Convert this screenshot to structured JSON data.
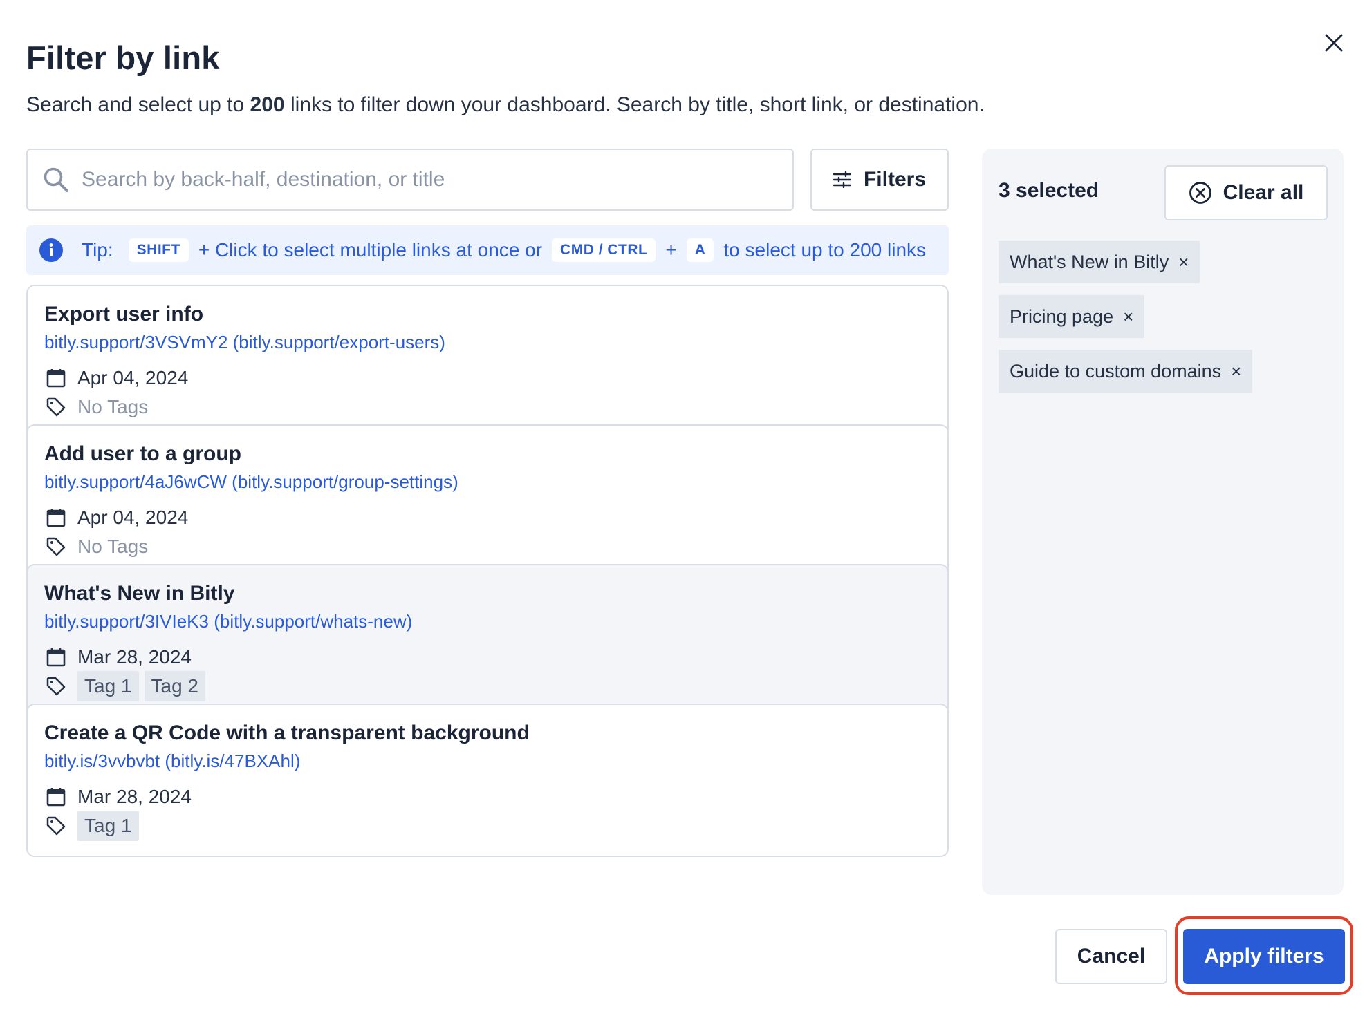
{
  "modal": {
    "title": "Filter by link",
    "subtitle_pre": "Search and select up to ",
    "subtitle_bold": "200",
    "subtitle_post": " links to filter down your dashboard. Search by title, short link, or destination.",
    "close_icon": "close-icon"
  },
  "search": {
    "placeholder": "Search by back-half, destination, or title",
    "value": "",
    "icon": "search-icon"
  },
  "filters_button": {
    "label": "Filters",
    "icon": "sliders-icon"
  },
  "tip": {
    "label": "Tip:",
    "key1": "SHIFT",
    "text1": "+ Click to select multiple links at once or",
    "key2": "CMD / CTRL",
    "plus": "+",
    "key3": "A",
    "text2": "to select up to 200 links",
    "icon": "info-icon"
  },
  "links": [
    {
      "title": "Export user info",
      "link": "bitly.support/3VSVmY2 (bitly.support/export-users)",
      "date": "Apr 04, 2024",
      "no_tags": "No Tags",
      "tags": [],
      "selected": false
    },
    {
      "title": "Add user to a group",
      "link": "bitly.support/4aJ6wCW (bitly.support/group-settings)",
      "date": "Apr 04, 2024",
      "no_tags": "No Tags",
      "tags": [],
      "selected": false
    },
    {
      "title": "What's New in Bitly",
      "link": "bitly.support/3IVIeK3 (bitly.support/whats-new)",
      "date": "Mar 28, 2024",
      "tags": [
        "Tag 1",
        "Tag 2"
      ],
      "selected": true
    },
    {
      "title": "Create a QR Code with a transparent background",
      "link": "bitly.is/3vvbvbt (bitly.is/47BXAhl)",
      "date": "Mar 28, 2024",
      "tags": [
        "Tag 1"
      ],
      "selected": false
    }
  ],
  "side_panel": {
    "selected_label": "3 selected",
    "clear_all_label": "Clear all",
    "chips": [
      "What's New in Bitly",
      "Pricing page",
      "Guide to custom domains"
    ],
    "chip_remove": "×"
  },
  "footer": {
    "cancel_label": "Cancel",
    "apply_label": "Apply filters"
  },
  "colors": {
    "accent": "#2a5bd7",
    "tip_bg": "#ecf2fe",
    "panel_bg": "#f3f5f9",
    "highlight_ring": "#e0402a"
  }
}
